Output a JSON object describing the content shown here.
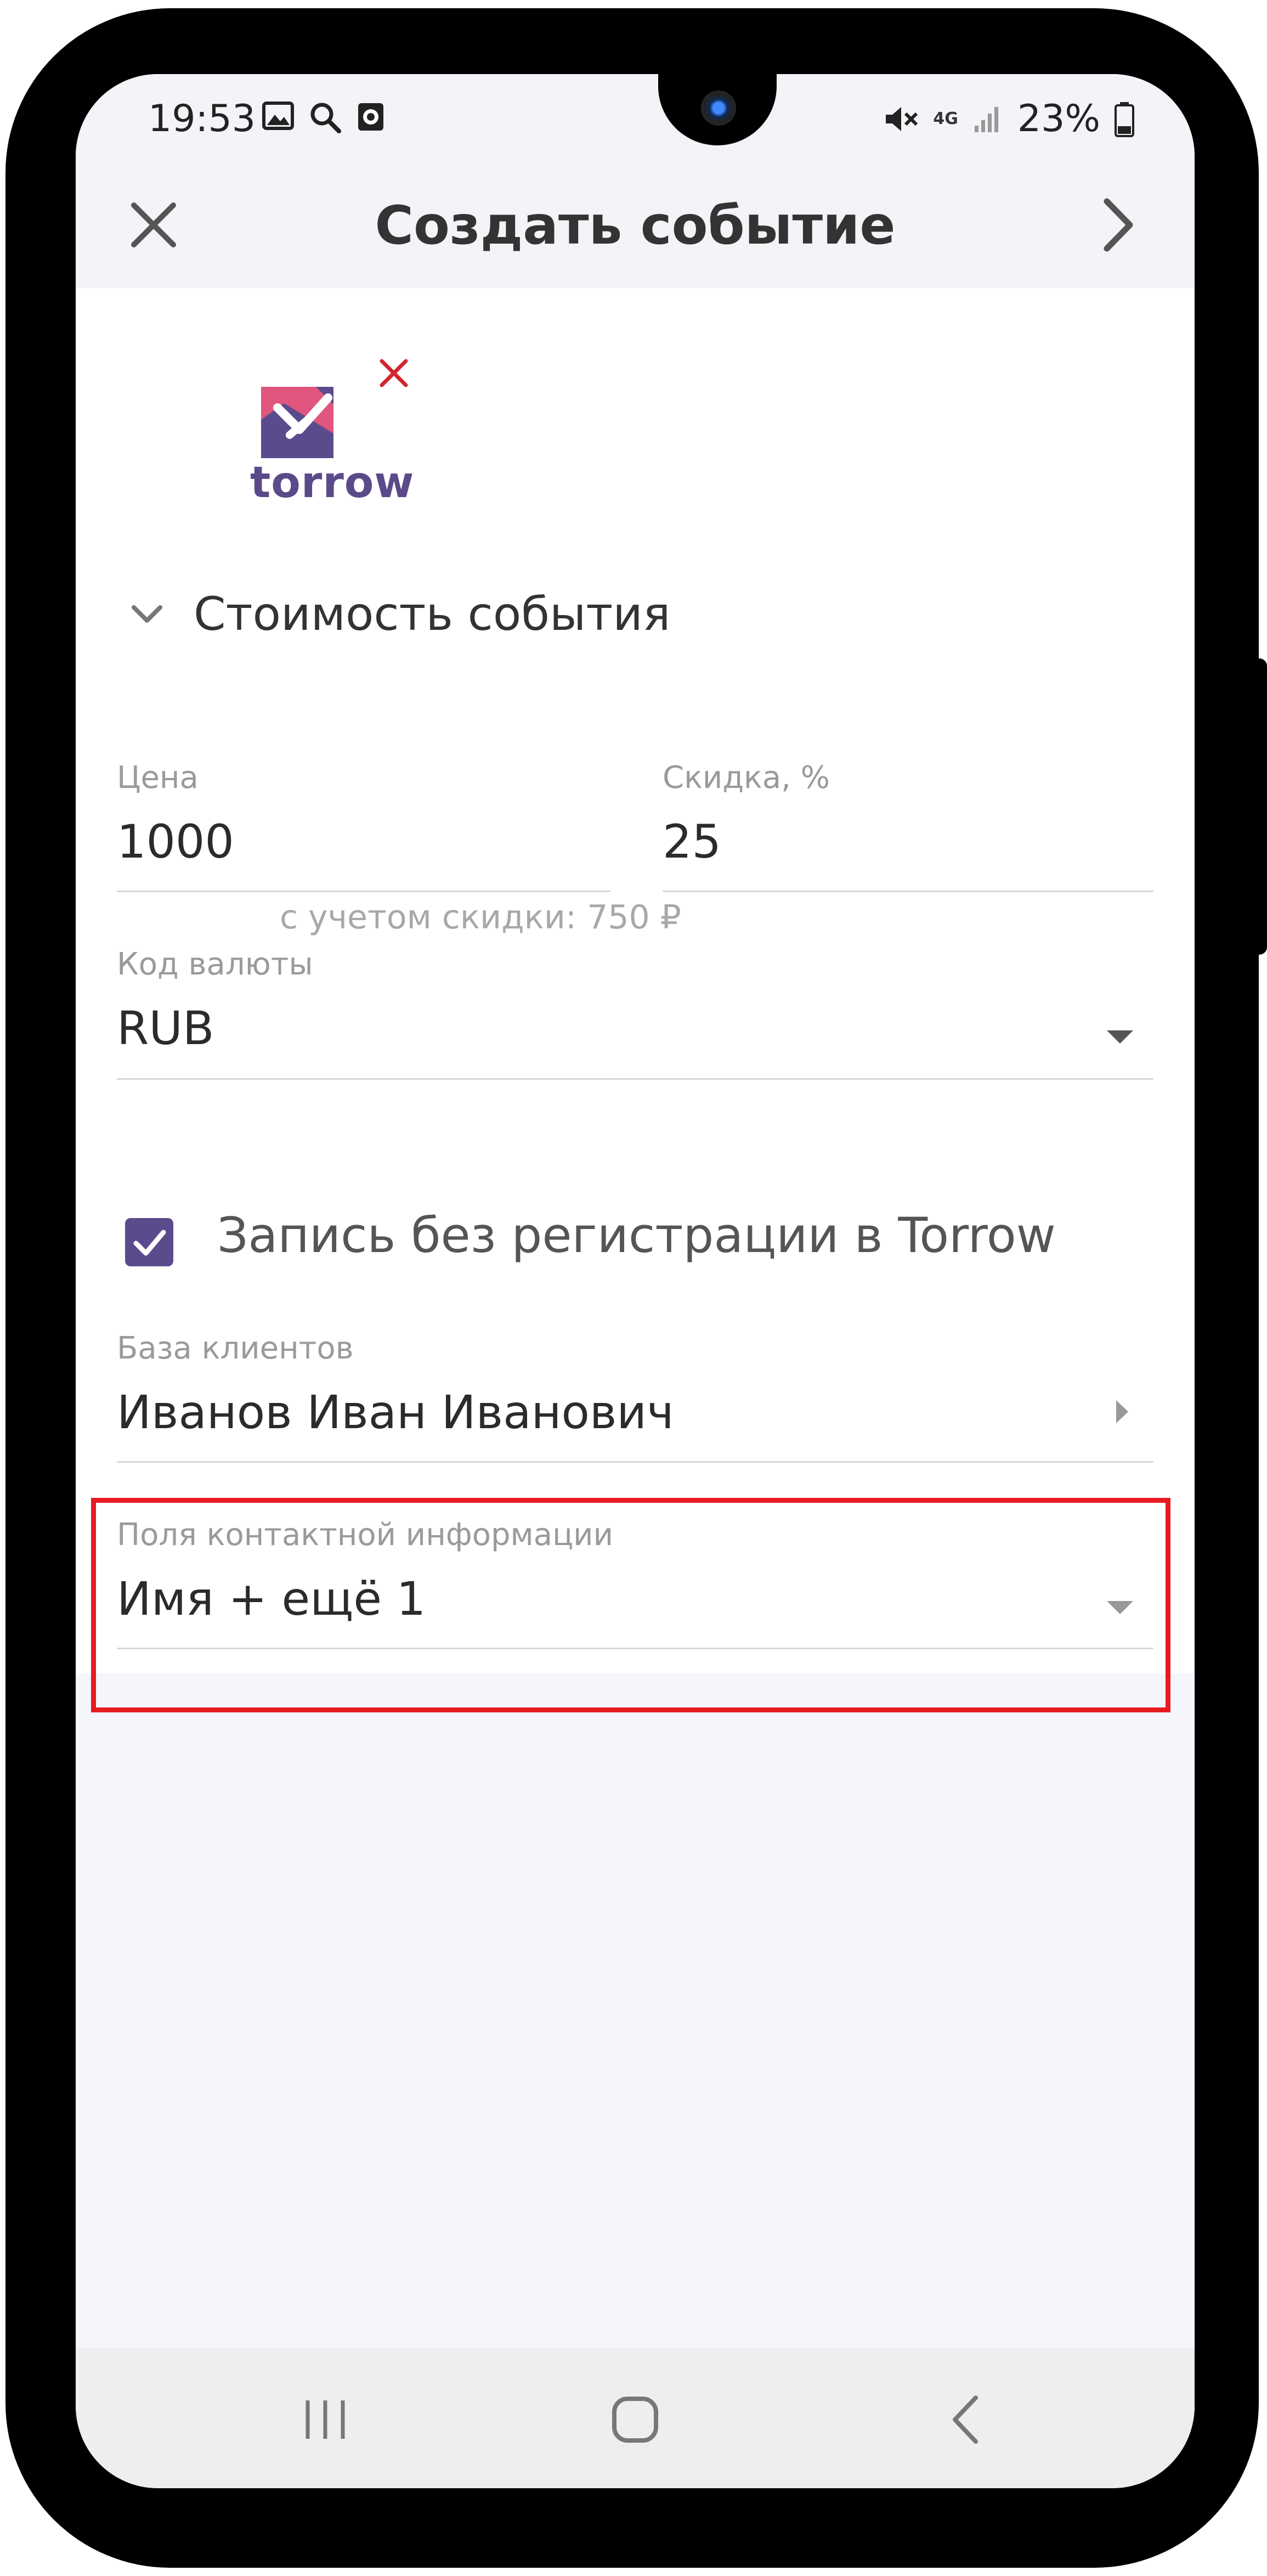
{
  "status_bar": {
    "time": "19:53",
    "left_icons": [
      "image-icon",
      "search-icon",
      "timer-icon"
    ],
    "right_icons": [
      "mute-icon",
      "4g-icon",
      "signal-icon"
    ],
    "network": "4G",
    "battery": "23%"
  },
  "appbar": {
    "title": "Создать событие",
    "close_icon": "close-icon",
    "next_icon": "chevron-right-icon"
  },
  "logo": {
    "text": "torrow",
    "remove_icon": "close-icon"
  },
  "section": {
    "title": "Стоимость события",
    "expanded": true
  },
  "price": {
    "label": "Цена",
    "value": "1000"
  },
  "discount": {
    "label": "Скидка, %",
    "value": "25",
    "hint": "с учетом скидки: 750 ₽"
  },
  "currency": {
    "label": "Код валюты",
    "value": "RUB"
  },
  "no_registration": {
    "label": "Запись без регистрации в Torrow",
    "checked": true
  },
  "client_base": {
    "label": "База клиентов",
    "value": "Иванов Иван Иванович"
  },
  "contact_fields": {
    "label": "Поля контактной информации",
    "value": "Имя + ещё 1"
  },
  "navbar": {
    "recent_icon": "recent-apps-icon",
    "home_icon": "home-icon",
    "back_icon": "back-icon"
  },
  "colors": {
    "accent": "#5a4b8d",
    "logo_pink": "#e0567f",
    "highlight": "#e81b23",
    "background": "#f4f6fc"
  }
}
